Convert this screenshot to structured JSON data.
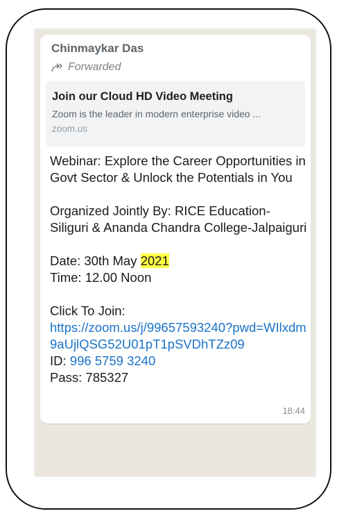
{
  "message": {
    "sender": "Chinmaykar Das",
    "forwarded_label": "Forwarded",
    "link_preview": {
      "title": "Join our Cloud HD Video Meeting",
      "description": "Zoom is the leader in modern enterprise video ...",
      "domain": "zoom.us"
    },
    "webinar_line": "Webinar: Explore the Career Opportunities in Govt Sector & Unlock the Potentials in You",
    "organizer_line": "Organized Jointly By: RICE Education-Siliguri & Ananda Chandra College-Jalpaiguri",
    "date_prefix": "Date: 30th May ",
    "date_year": "2021",
    "time_line": "Time: 12.00 Noon",
    "join_label": "Click To Join:",
    "join_url": "https://zoom.us/j/99657593240?pwd=WIlxdm9aUjlQSG52U01pT1pSVDhTZz09",
    "id_label": "ID: ",
    "meeting_id": "996 5759 3240",
    "pass_line": "Pass: 785327",
    "timestamp": "18:44"
  },
  "colors": {
    "chat_background": "#ebe7df",
    "bubble": "#ffffff",
    "link": "#1a73c8",
    "highlight": "#ffff44"
  }
}
